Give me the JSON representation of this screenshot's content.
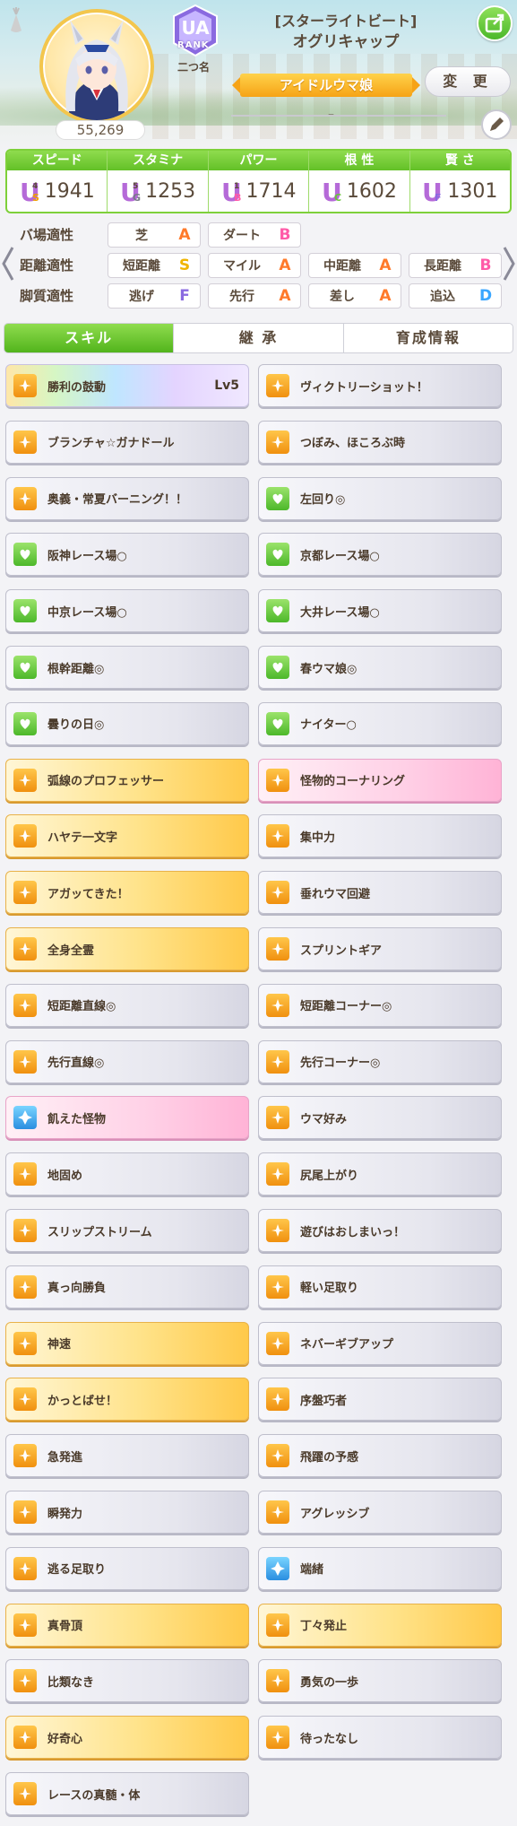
{
  "header": {
    "fan_count": "55,269",
    "rank_label": "RANK",
    "rank_grade": "UA",
    "nickname": "二つ名",
    "costume": "[スターライトビート]",
    "character": "オグリキャップ",
    "title": "アイドルウマ娘",
    "change_label": "変 更",
    "title_placeholder": "–"
  },
  "stats": [
    {
      "label": "スピード",
      "icon": "shoe-icon",
      "grade": "U",
      "sub": "S",
      "sub_num": "4",
      "value": "1941"
    },
    {
      "label": "スタミナ",
      "icon": "heart-icon",
      "grade": "U",
      "sub": "G",
      "sub_num": "5",
      "value": "1253"
    },
    {
      "label": "パワー",
      "icon": "arm-icon",
      "grade": "U",
      "sub": "B",
      "sub_num": "1",
      "value": "1714"
    },
    {
      "label": "根 性",
      "icon": "flame-icon",
      "grade": "U",
      "sub": "C",
      "sub_num": "",
      "value": "1602"
    },
    {
      "label": "賢 さ",
      "icon": "graduation-cap-icon",
      "grade": "U",
      "sub": "F",
      "sub_num": "",
      "value": "1301"
    }
  ],
  "aptitude": {
    "track_label": "バ場適性",
    "distance_label": "距離適性",
    "style_label": "脚質適性",
    "track": [
      {
        "name": "芝",
        "grade": "A"
      },
      {
        "name": "ダート",
        "grade": "B"
      }
    ],
    "distance": [
      {
        "name": "短距離",
        "grade": "S"
      },
      {
        "name": "マイル",
        "grade": "A"
      },
      {
        "name": "中距離",
        "grade": "A"
      },
      {
        "name": "長距離",
        "grade": "B"
      }
    ],
    "style": [
      {
        "name": "逃げ",
        "grade": "F"
      },
      {
        "name": "先行",
        "grade": "A"
      },
      {
        "name": "差し",
        "grade": "A"
      },
      {
        "name": "追込",
        "grade": "D"
      }
    ],
    "grade_colors": {
      "S": "#f0b400",
      "A": "#ff7a2a",
      "B": "#ff5aa8",
      "C": "#6ac43a",
      "D": "#3aa6ff",
      "F": "#8a6ae0"
    }
  },
  "tabs": [
    "スキル",
    "継 承",
    "育成情報"
  ],
  "skills": [
    {
      "name": "勝利の鼓動",
      "lv": "Lv5",
      "style": "rainbow",
      "icon": "speed-icon"
    },
    {
      "name": "ヴィクトリーショット！",
      "lv": "",
      "style": "plain",
      "icon": "speed-icon"
    },
    {
      "name": "ブランチャ☆ガナドール",
      "lv": "",
      "style": "plain",
      "icon": "speed-icon"
    },
    {
      "name": "つぼみ、ほころぶ時",
      "lv": "",
      "style": "plain",
      "icon": "speed-icon"
    },
    {
      "name": "奥義・常夏バーニング！！",
      "lv": "",
      "style": "plain",
      "icon": "speed-icon"
    },
    {
      "name": "左回り◎",
      "lv": "",
      "style": "plain",
      "icon": "green-icon"
    },
    {
      "name": "阪神レース場○",
      "lv": "",
      "style": "plain",
      "icon": "green-icon"
    },
    {
      "name": "京都レース場○",
      "lv": "",
      "style": "plain",
      "icon": "green-icon"
    },
    {
      "name": "中京レース場○",
      "lv": "",
      "style": "plain",
      "icon": "green-icon"
    },
    {
      "name": "大井レース場○",
      "lv": "",
      "style": "plain",
      "icon": "green-icon"
    },
    {
      "name": "根幹距離◎",
      "lv": "",
      "style": "plain",
      "icon": "green-icon"
    },
    {
      "name": "春ウマ娘◎",
      "lv": "",
      "style": "plain",
      "icon": "green-icon"
    },
    {
      "name": "曇りの日◎",
      "lv": "",
      "style": "plain",
      "icon": "green-icon"
    },
    {
      "name": "ナイター○",
      "lv": "",
      "style": "plain",
      "icon": "green-icon"
    },
    {
      "name": "弧線のプロフェッサー",
      "lv": "",
      "style": "gold",
      "icon": "speed-icon"
    },
    {
      "name": "怪物的コーナリング",
      "lv": "",
      "style": "pink",
      "icon": "speed-icon"
    },
    {
      "name": "ハヤテ一文字",
      "lv": "",
      "style": "gold",
      "icon": "speed-icon"
    },
    {
      "name": "集中力",
      "lv": "",
      "style": "plain",
      "icon": "speed-icon"
    },
    {
      "name": "アガッてきた！",
      "lv": "",
      "style": "gold",
      "icon": "speed-icon"
    },
    {
      "name": "垂れウマ回避",
      "lv": "",
      "style": "plain",
      "icon": "speed-icon"
    },
    {
      "name": "全身全霊",
      "lv": "",
      "style": "gold",
      "icon": "speed-icon"
    },
    {
      "name": "スプリントギア",
      "lv": "",
      "style": "plain",
      "icon": "speed-icon"
    },
    {
      "name": "短距離直線◎",
      "lv": "",
      "style": "plain",
      "icon": "speed-icon"
    },
    {
      "name": "短距離コーナー◎",
      "lv": "",
      "style": "plain",
      "icon": "speed-icon"
    },
    {
      "name": "先行直線◎",
      "lv": "",
      "style": "plain",
      "icon": "speed-icon"
    },
    {
      "name": "先行コーナー◎",
      "lv": "",
      "style": "plain",
      "icon": "speed-icon"
    },
    {
      "name": "飢えた怪物",
      "lv": "",
      "style": "pink",
      "icon": "blue-icon"
    },
    {
      "name": "ウマ好み",
      "lv": "",
      "style": "plain",
      "icon": "speed-icon"
    },
    {
      "name": "地固め",
      "lv": "",
      "style": "plain",
      "icon": "speed-icon"
    },
    {
      "name": "尻尾上がり",
      "lv": "",
      "style": "plain",
      "icon": "speed-icon"
    },
    {
      "name": "スリップストリーム",
      "lv": "",
      "style": "plain",
      "icon": "speed-icon"
    },
    {
      "name": "遊びはおしまいっ！",
      "lv": "",
      "style": "plain",
      "icon": "speed-icon"
    },
    {
      "name": "真っ向勝負",
      "lv": "",
      "style": "plain",
      "icon": "speed-icon"
    },
    {
      "name": "軽い足取り",
      "lv": "",
      "style": "plain",
      "icon": "speed-icon"
    },
    {
      "name": "神速",
      "lv": "",
      "style": "gold",
      "icon": "speed-icon"
    },
    {
      "name": "ネバーギブアップ",
      "lv": "",
      "style": "plain",
      "icon": "speed-icon"
    },
    {
      "name": "かっとばせ！",
      "lv": "",
      "style": "gold",
      "icon": "speed-icon"
    },
    {
      "name": "序盤巧者",
      "lv": "",
      "style": "plain",
      "icon": "speed-icon"
    },
    {
      "name": "急発進",
      "lv": "",
      "style": "plain",
      "icon": "speed-icon"
    },
    {
      "name": "飛躍の予感",
      "lv": "",
      "style": "plain",
      "icon": "speed-icon"
    },
    {
      "name": "瞬発力",
      "lv": "",
      "style": "plain",
      "icon": "speed-icon"
    },
    {
      "name": "アグレッシブ",
      "lv": "",
      "style": "plain",
      "icon": "speed-icon"
    },
    {
      "name": "逃る足取り",
      "lv": "",
      "style": "plain",
      "icon": "speed-icon"
    },
    {
      "name": "端緒",
      "lv": "",
      "style": "plain",
      "icon": "blue-icon"
    },
    {
      "name": "真骨頂",
      "lv": "",
      "style": "gold",
      "icon": "speed-icon"
    },
    {
      "name": "丁々発止",
      "lv": "",
      "style": "gold",
      "icon": "speed-icon"
    },
    {
      "name": "比類なき",
      "lv": "",
      "style": "plain",
      "icon": "speed-icon"
    },
    {
      "name": "勇気の一歩",
      "lv": "",
      "style": "plain",
      "icon": "speed-icon"
    },
    {
      "name": "好奇心",
      "lv": "",
      "style": "gold",
      "icon": "speed-icon"
    },
    {
      "name": "待ったなし",
      "lv": "",
      "style": "plain",
      "icon": "speed-icon"
    },
    {
      "name": "レースの真髄・体",
      "lv": "",
      "style": "plain",
      "icon": "speed-icon"
    }
  ]
}
